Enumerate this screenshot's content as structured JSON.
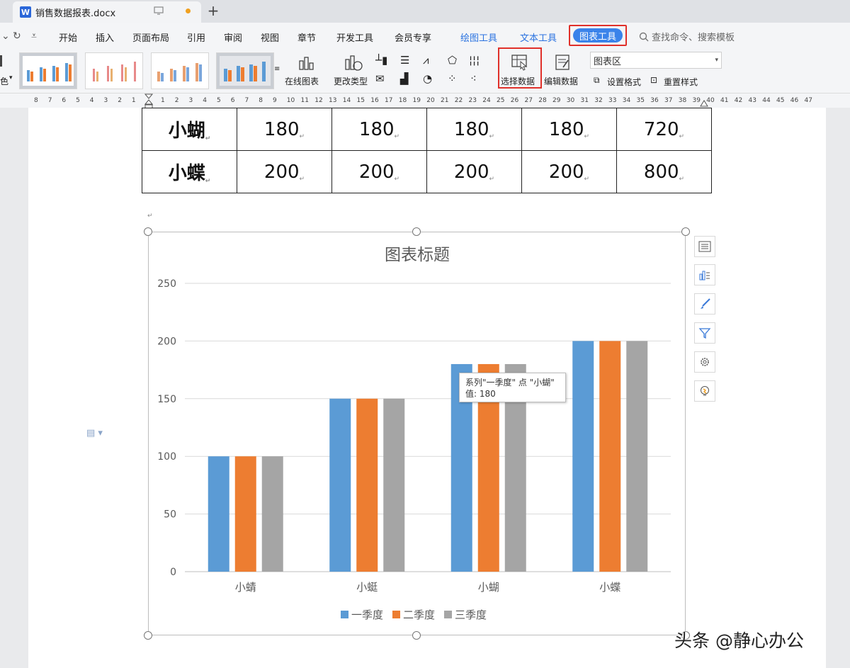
{
  "titlebar": {
    "doc_name": "销售数据报表.docx",
    "app_icon_letter": "W"
  },
  "menu": {
    "items": [
      "开始",
      "插入",
      "页面布局",
      "引用",
      "审阅",
      "视图",
      "章节",
      "开发工具",
      "会员专享"
    ],
    "context_tabs": [
      "绘图工具",
      "文本工具"
    ],
    "chart_tools": "图表工具",
    "search_placeholder": "查找命令、搜索模板"
  },
  "ribbon": {
    "color_label": "色",
    "online_chart": "在线图表",
    "change_type": "更改类型",
    "select_data": "选择数据",
    "edit_data": "编辑数据",
    "element_select": "图表区",
    "set_format": "设置格式",
    "reset_style": "重置样式"
  },
  "ruler": {
    "left_numbers": [
      "8",
      "7",
      "6",
      "5",
      "4",
      "3",
      "2",
      "1"
    ],
    "right_numbers": [
      "1",
      "2",
      "3",
      "4",
      "5",
      "6",
      "7",
      "8",
      "9",
      "10",
      "11",
      "12",
      "13",
      "14",
      "15",
      "16",
      "17",
      "18",
      "19",
      "20",
      "21",
      "22",
      "23",
      "24",
      "25",
      "26",
      "27",
      "28",
      "29",
      "30",
      "31",
      "32",
      "33",
      "34",
      "35",
      "36",
      "37",
      "38",
      "39",
      "40",
      "41",
      "42",
      "43",
      "44",
      "45",
      "46",
      "47"
    ]
  },
  "table": {
    "rows": [
      [
        "小蝴",
        "180",
        "180",
        "180",
        "180",
        "720"
      ],
      [
        "小蝶",
        "200",
        "200",
        "200",
        "200",
        "800"
      ]
    ]
  },
  "tooltip": {
    "line1": "系列\"一季度\" 点 \"小蝴\"",
    "line2": "值: 180"
  },
  "chart_data": {
    "type": "bar",
    "title": "图表标题",
    "categories": [
      "小蜻",
      "小蜓",
      "小蝴",
      "小蝶"
    ],
    "series": [
      {
        "name": "一季度",
        "values": [
          100,
          150,
          180,
          200
        ],
        "color": "#5b9bd5"
      },
      {
        "name": "二季度",
        "values": [
          100,
          150,
          180,
          200
        ],
        "color": "#ed7d31"
      },
      {
        "name": "三季度",
        "values": [
          100,
          150,
          180,
          200
        ],
        "color": "#a5a5a5"
      }
    ],
    "ylim": [
      0,
      250
    ],
    "yticks": [
      0,
      50,
      100,
      150,
      200,
      250
    ],
    "grid": true,
    "legend": "bottom"
  },
  "watermark": "头条 @静心办公"
}
